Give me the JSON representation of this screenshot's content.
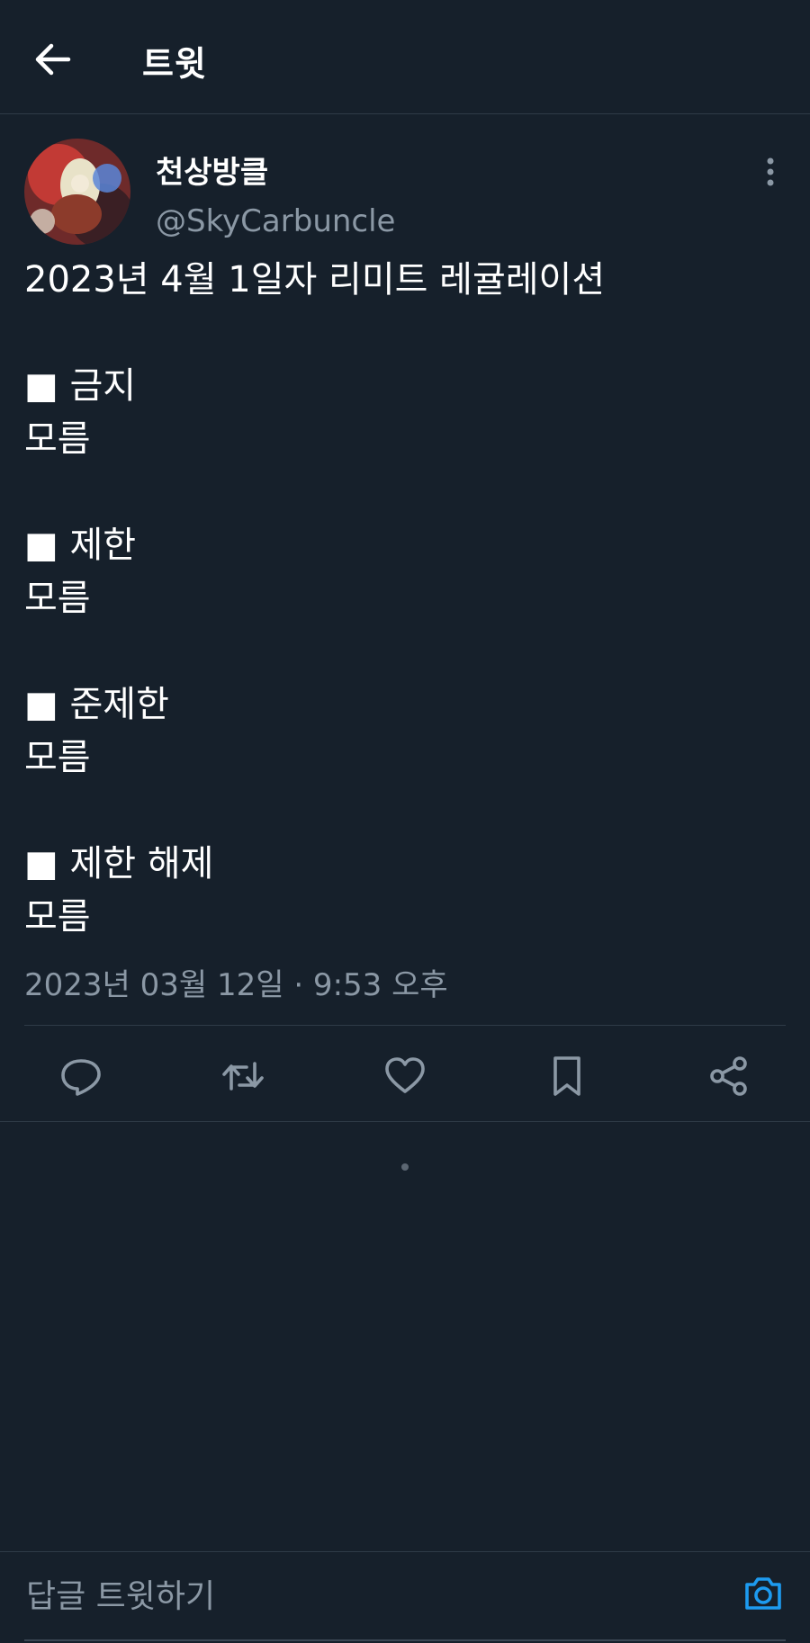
{
  "header": {
    "title": "트윗",
    "back_icon": "arrow-left-icon"
  },
  "tweet": {
    "author": {
      "display_name": "천상방클",
      "handle": "@SkyCarbuncle",
      "avatar": "avatar-image"
    },
    "text": "2023년 4월 1일자 리미트 레귤레이션\n\n■ 금지\n모름\n\n■ 제한\n모름\n\n■ 준제한\n모름\n\n■ 제한 해제\n모름",
    "timestamp": "2023년 03월 12일 · 9:53 오후",
    "more_icon": "more-vertical-icon"
  },
  "actions": [
    {
      "name": "reply",
      "icon": "reply-icon"
    },
    {
      "name": "retweet",
      "icon": "retweet-icon"
    },
    {
      "name": "like",
      "icon": "heart-icon"
    },
    {
      "name": "bookmark",
      "icon": "bookmark-icon"
    },
    {
      "name": "share",
      "icon": "share-icon"
    }
  ],
  "reply_bar": {
    "placeholder": "답글 트윗하기",
    "camera_icon": "camera-icon"
  },
  "colors": {
    "background": "#16202b",
    "text_primary": "#ffffff",
    "text_secondary": "#8b98a5",
    "divider": "#2f3b47",
    "accent": "#1d9bf0"
  }
}
